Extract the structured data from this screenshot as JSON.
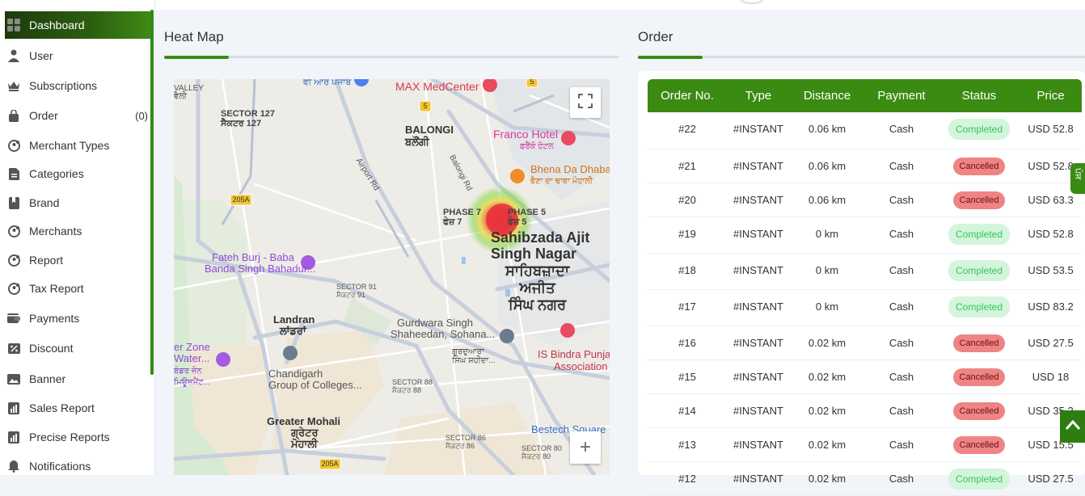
{
  "sidebar": {
    "items": [
      {
        "label": "Dashboard",
        "icon": "grid-icon",
        "active": true
      },
      {
        "label": "User",
        "icon": "user-icon"
      },
      {
        "label": "Subscriptions",
        "icon": "crown-icon"
      },
      {
        "label": "Order",
        "icon": "bag-icon",
        "count": "(0)"
      },
      {
        "label": "Merchant Types",
        "icon": "merchant-type-icon"
      },
      {
        "label": "Categories",
        "icon": "categories-icon"
      },
      {
        "label": "Brand",
        "icon": "bookmark-icon"
      },
      {
        "label": "Merchants",
        "icon": "merchant-icon"
      },
      {
        "label": "Report",
        "icon": "report-icon"
      },
      {
        "label": "Tax Report",
        "icon": "tax-report-icon"
      },
      {
        "label": "Payments",
        "icon": "wallet-icon"
      },
      {
        "label": "Discount",
        "icon": "discount-icon"
      },
      {
        "label": "Banner",
        "icon": "image-icon"
      },
      {
        "label": "Sales Report",
        "icon": "sales-report-icon"
      },
      {
        "label": "Precise Reports",
        "icon": "precise-report-icon"
      },
      {
        "label": "Notifications",
        "icon": "bell-icon"
      }
    ]
  },
  "heatmap": {
    "title": "Heat Map",
    "labels": {
      "valley": "VALLEY",
      "valley_pa": "ਵੈਲੀ",
      "sector127": "SECTOR 127",
      "sector127_pa": "ਸੈਕਟਰ 127",
      "vr_punjab": "ਵੀ ਆਰ ਪੰਜਾਬ",
      "max": "MAX MedCenter",
      "balongi": "BALONGI",
      "balongi_pa": "ਬਲੌਂਗੀ",
      "franco": "Franco Hotel",
      "franco_pa": "ਫ਼ਰੈਂਕੋ ਹੋਟਲ",
      "airport_rd": "Airport Rd",
      "balongi_rd": "Balongi Rd",
      "bhena": "Bhena Da Dhaba",
      "bhena_pa": "ਭੈਣਾ ਦਾ ਢਾਬਾ ਮੋਹਾਲੀ",
      "phase7": "PHASE 7",
      "phase7_pa": "ਫੇਜ਼ 7",
      "phase5": "PHASE 5",
      "phase5_pa": "ਫੇਜ਼ 5",
      "sas1": "Sahibzada Ajit",
      "sas2": "Singh Nagar",
      "sas_pa1": "ਸਾਹਿਬਜ਼ਾਦਾ",
      "sas_pa2": "ਅਜੀਤ",
      "sas_pa3": "ਸਿੰਘ ਨਗਰ",
      "fateh1": "Fateh Burj - Baba",
      "fateh2": "Banda Singh Bahadur...",
      "sector91": "SECTOR 91",
      "sector91_pa": "ਸੈਕਟਰ 91",
      "landran": "Landran",
      "landran_pa": "ਲਾਂਡਰਾਂ",
      "gurdwara1": "Gurdwara Singh",
      "gurdwara2": "Shaheedan, Sohana...",
      "gurdwara_pa1": "ਗੁਰਦੁਆਰਾ",
      "gurdwara_pa2": "ਸਿੰਘ ਸ਼ਹੀਦਾ...",
      "isbindra1": "IS Bindra Punjab",
      "isbindra2": "Association",
      "zone1": "er Zone",
      "zone2": "Water...",
      "zone_pa1": "ਬੰਡਰ ਜ਼ੋਨ",
      "zone_pa2": "ਮਿਊਜ਼ਮੈਂਟ...",
      "chandigarh1": "Chandigarh",
      "chandigarh2": "Group of Colleges...",
      "sector88": "SECTOR 88",
      "sector88_pa": "ਸੈਕਟਰ 88",
      "greater": "Greater Mohali",
      "greater_pa1": "ਗ੍ਰੇਟਰ",
      "greater_pa2": "ਮੋਹਾਲੀ",
      "sector86": "SECTOR 86",
      "sector86_pa": "ਸੈਕਟਰ 86",
      "sector80": "SECTOR 80",
      "sector80_pa": "ਸੈਕਟਰ 80",
      "bestech": "Bestech Square",
      "shield5a": "5",
      "shield5b": "5",
      "shield205a": "205A",
      "shield205b": "205A",
      "zoom_in": "+"
    }
  },
  "orders": {
    "title": "Order",
    "columns": [
      "Order No.",
      "Type",
      "Distance",
      "Payment",
      "Status",
      "Price"
    ],
    "rows": [
      {
        "no": "#22",
        "type": "#INSTANT",
        "distance": "0.06 km",
        "payment": "Cash",
        "status": "Completed",
        "price": "USD 52.8"
      },
      {
        "no": "#21",
        "type": "#INSTANT",
        "distance": "0.06 km",
        "payment": "Cash",
        "status": "Cancelled",
        "price": "USD 52.8"
      },
      {
        "no": "#20",
        "type": "#INSTANT",
        "distance": "0.06 km",
        "payment": "Cash",
        "status": "Cancelled",
        "price": "USD 63.3"
      },
      {
        "no": "#19",
        "type": "#INSTANT",
        "distance": "0 km",
        "payment": "Cash",
        "status": "Completed",
        "price": "USD 52.8"
      },
      {
        "no": "#18",
        "type": "#INSTANT",
        "distance": "0 km",
        "payment": "Cash",
        "status": "Completed",
        "price": "USD 53.5"
      },
      {
        "no": "#17",
        "type": "#INSTANT",
        "distance": "0 km",
        "payment": "Cash",
        "status": "Completed",
        "price": "USD 83.2"
      },
      {
        "no": "#16",
        "type": "#INSTANT",
        "distance": "0.02 km",
        "payment": "Cash",
        "status": "Cancelled",
        "price": "USD 27.5"
      },
      {
        "no": "#15",
        "type": "#INSTANT",
        "distance": "0.02 km",
        "payment": "Cash",
        "status": "Cancelled",
        "price": "USD 18"
      },
      {
        "no": "#14",
        "type": "#INSTANT",
        "distance": "0.02 km",
        "payment": "Cash",
        "status": "Cancelled",
        "price": "USD 35.2"
      },
      {
        "no": "#13",
        "type": "#INSTANT",
        "distance": "0.02 km",
        "payment": "Cash",
        "status": "Cancelled",
        "price": "USD 15.5"
      },
      {
        "no": "#12",
        "type": "#INSTANT",
        "distance": "0.02 km",
        "payment": "Cash",
        "status": "Completed",
        "price": "USD 27.5"
      }
    ]
  },
  "side_tab": {
    "label": "ਪੰਜ"
  },
  "colors": {
    "accent": "#3b8a12",
    "completed_bg": "#d3f5dc",
    "completed_text": "#34c759",
    "cancelled_bg": "#f08484",
    "heat_core": "#e83b3b"
  }
}
